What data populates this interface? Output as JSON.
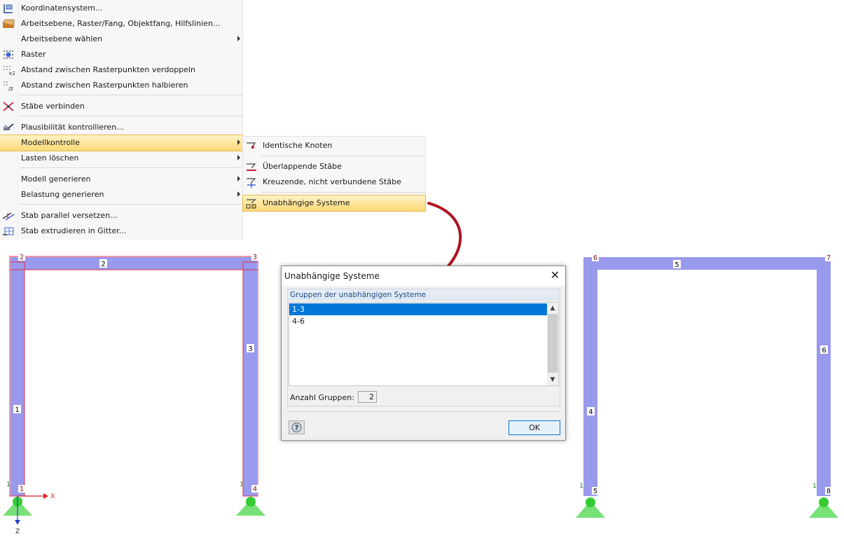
{
  "menu": {
    "items": [
      {
        "label": "Koordinatensystem...",
        "icon": "coordinate-system-icon"
      },
      {
        "label": "Arbeitsebene, Raster/Fang, Objektfang, Hilfslinien...",
        "icon": "work-plane-icon"
      },
      {
        "label": "Arbeitsebene wählen",
        "icon": "",
        "submenu": true
      },
      {
        "label": "Raster",
        "icon": "grid-icon"
      },
      {
        "label": "Abstand zwischen Rasterpunkten verdoppeln",
        "icon": "grid-double-icon"
      },
      {
        "label": "Abstand zwischen Rasterpunkten halbieren",
        "icon": "grid-half-icon"
      },
      {
        "label": "Stäbe verbinden",
        "icon": "connect-members-icon"
      },
      {
        "label": "Plausibilität kontrollieren...",
        "icon": "plausibility-check-icon"
      },
      {
        "label": "Modellkontrolle",
        "icon": "",
        "submenu": true,
        "highlighted": true
      },
      {
        "label": "Lasten löschen",
        "icon": "",
        "submenu": true
      },
      {
        "label": "Modell generieren",
        "icon": "",
        "submenu": true
      },
      {
        "label": "Belastung generieren",
        "icon": "",
        "submenu": true
      },
      {
        "label": "Stab parallel versetzen...",
        "icon": "offset-member-icon"
      },
      {
        "label": "Stab extrudieren in Gitter...",
        "icon": "extrude-member-icon"
      }
    ]
  },
  "submenu": {
    "items": [
      {
        "label": "Identische Knoten",
        "icon": "identical-nodes-icon"
      },
      {
        "label": "Überlappende Stäbe",
        "icon": "overlapping-members-icon"
      },
      {
        "label": "Kreuzende, nicht verbundene Stäbe",
        "icon": "crossing-members-icon"
      },
      {
        "label": "Unabhängige Systeme",
        "icon": "independent-systems-icon",
        "highlighted": true
      }
    ]
  },
  "dialog": {
    "title": "Unabhängige Systeme",
    "close_glyph": "✕",
    "group_title": "Gruppen der unabhängigen Systeme",
    "list": [
      "1-3",
      "4-6"
    ],
    "selected_index": 0,
    "count_label": "Anzahl Gruppen:",
    "count_value": "2",
    "ok_label": "OK"
  },
  "frame_left": {
    "nodes": [
      "1",
      "2",
      "3",
      "4"
    ],
    "members": [
      "1",
      "2",
      "3"
    ],
    "supports": [
      "1",
      "1"
    ],
    "axes": {
      "x": "X",
      "z": "Z"
    }
  },
  "frame_right": {
    "nodes": [
      "5",
      "6",
      "7",
      "8"
    ],
    "members": [
      "4",
      "5",
      "6"
    ],
    "supports": [
      "1",
      "1"
    ]
  },
  "colors": {
    "member_fill": "#9999ee",
    "selection": "#e0304a",
    "support": "#66dd66",
    "node_label": "#7a1010",
    "arrow": "#b01020",
    "accent": "#0078d7"
  }
}
